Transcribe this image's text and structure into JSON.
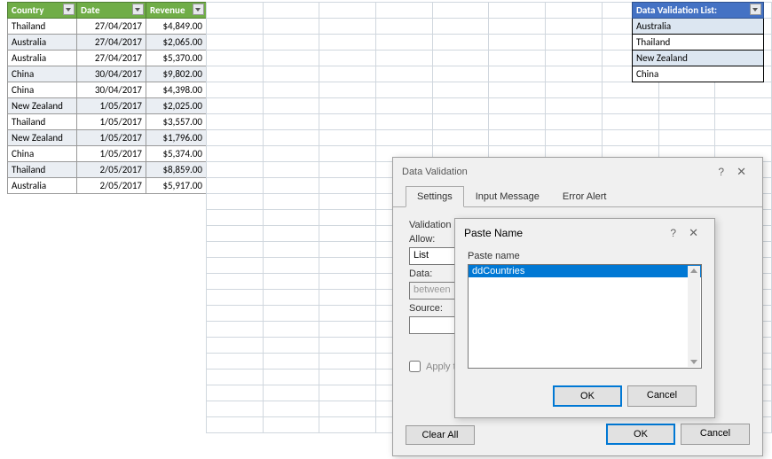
{
  "table": {
    "headers": [
      "Country",
      "Date",
      "Revenue"
    ],
    "rows": [
      {
        "country": "Thailand",
        "date": "27/04/2017",
        "revenue": "$4,849.00"
      },
      {
        "country": "Australia",
        "date": "27/04/2017",
        "revenue": "$2,065.00"
      },
      {
        "country": "Australia",
        "date": "27/04/2017",
        "revenue": "$5,370.00"
      },
      {
        "country": "China",
        "date": "30/04/2017",
        "revenue": "$9,802.00"
      },
      {
        "country": "China",
        "date": "30/04/2017",
        "revenue": "$4,398.00"
      },
      {
        "country": "New Zealand",
        "date": "1/05/2017",
        "revenue": "$2,025.00"
      },
      {
        "country": "Thailand",
        "date": "1/05/2017",
        "revenue": "$3,557.00"
      },
      {
        "country": "New Zealand",
        "date": "1/05/2017",
        "revenue": "$1,796.00"
      },
      {
        "country": "China",
        "date": "1/05/2017",
        "revenue": "$5,374.00"
      },
      {
        "country": "Thailand",
        "date": "2/05/2017",
        "revenue": "$8,859.00"
      },
      {
        "country": "Australia",
        "date": "2/05/2017",
        "revenue": "$5,917.00"
      }
    ]
  },
  "validation_list": {
    "header": "Data Validation List:",
    "items": [
      "Australia",
      "Thailand",
      "New Zealand",
      "China"
    ]
  },
  "dialog_main": {
    "title": "Data Validation",
    "tabs": [
      "Settings",
      "Input Message",
      "Error Alert"
    ],
    "validation_criteria_label": "Validation",
    "allow_label": "Allow:",
    "allow_value": "List",
    "data_label": "Data:",
    "data_value": "between",
    "source_label": "Source:",
    "apply_label": "Apply these changes to all other cells with the same settings",
    "clear_all": "Clear All",
    "ok": "OK",
    "cancel": "Cancel"
  },
  "dialog_paste": {
    "title": "Paste Name",
    "paste_name_label": "Paste name",
    "item": "ddCountries",
    "ok": "OK",
    "cancel": "Cancel"
  }
}
